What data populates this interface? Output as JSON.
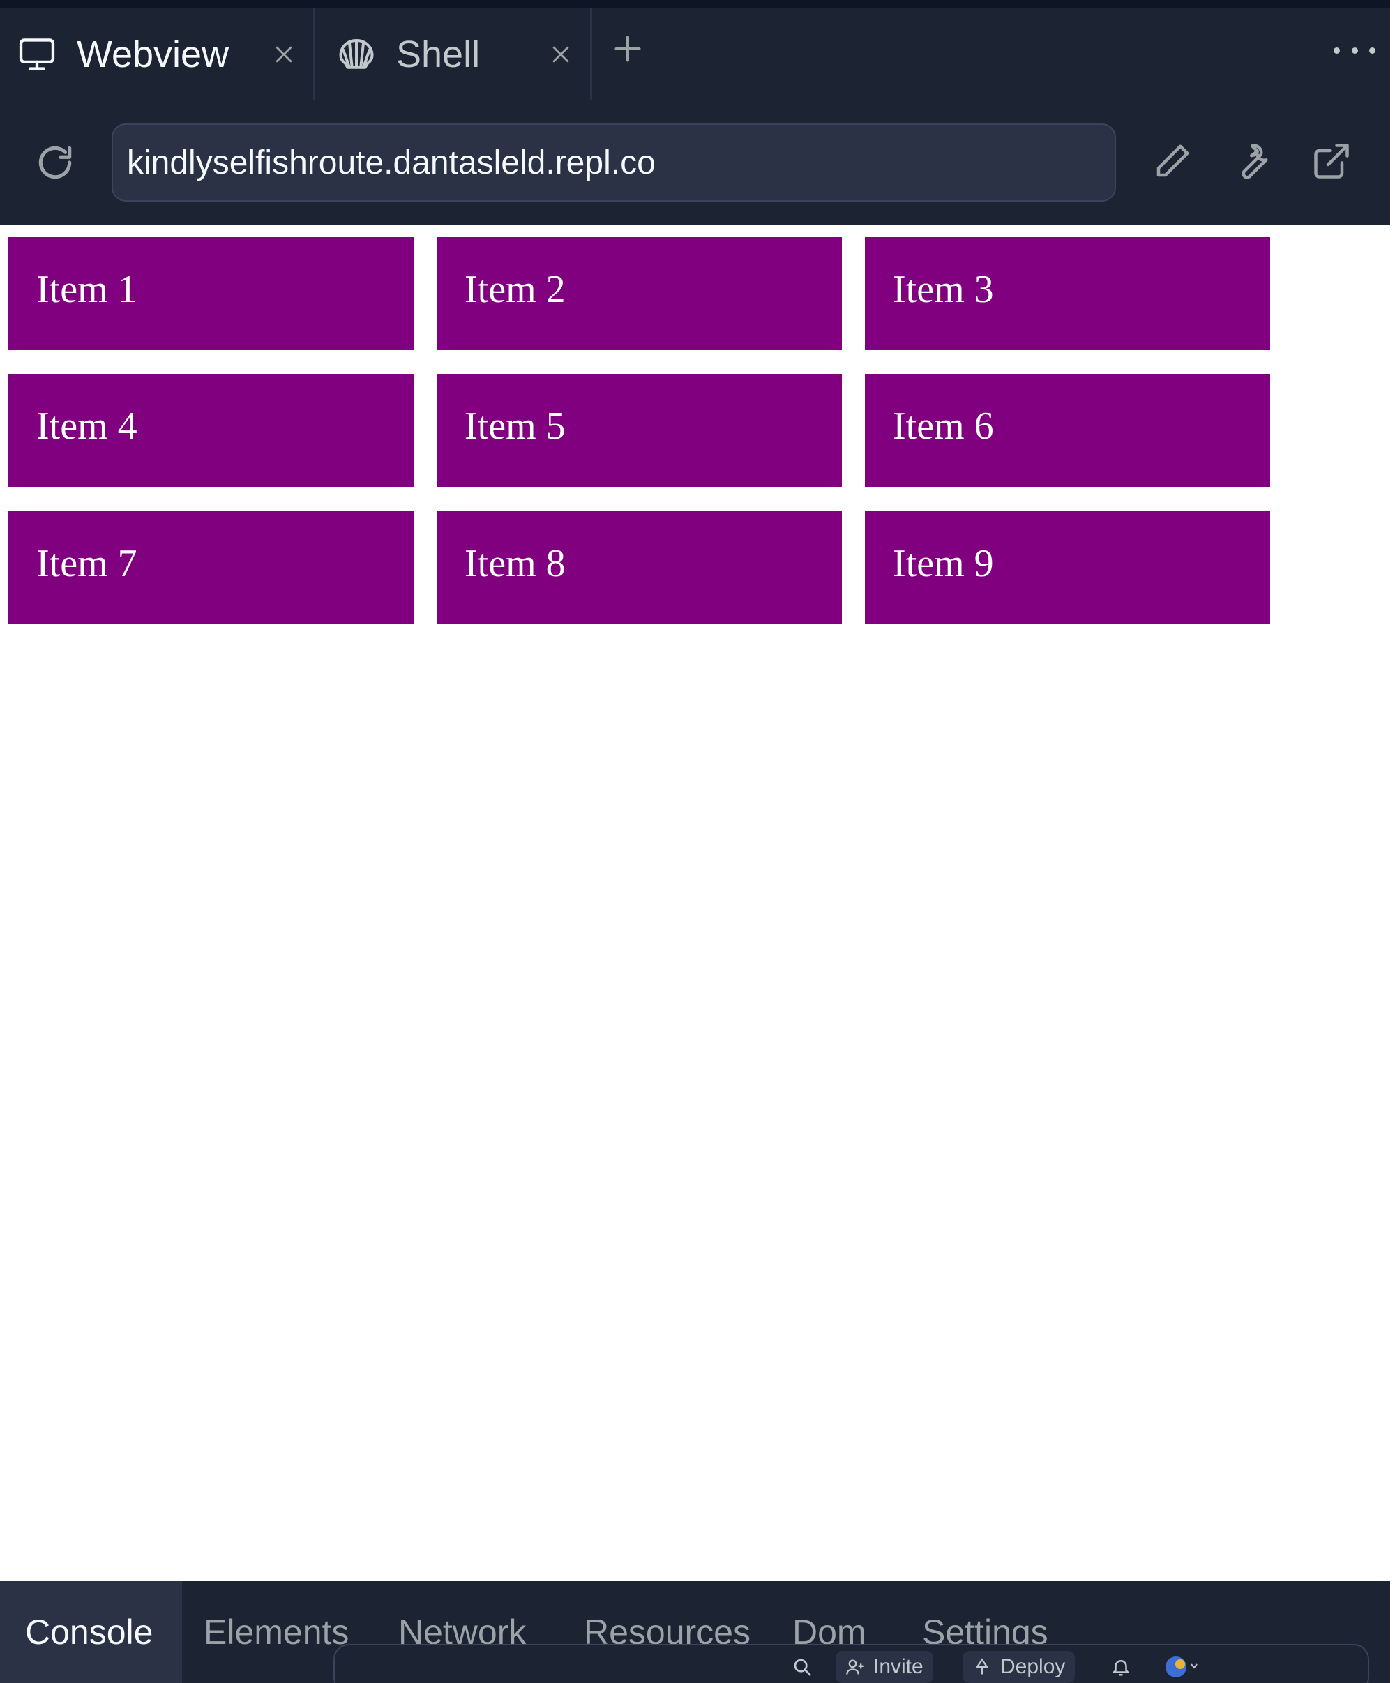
{
  "tabs": [
    {
      "label": "Webview",
      "icon": "monitor-icon",
      "active": true
    },
    {
      "label": "Shell",
      "icon": "shell-icon",
      "active": false
    }
  ],
  "address_bar": {
    "url": "kindlyselfishroute.dantasleld.repl.co"
  },
  "page": {
    "item_color": "#800080",
    "items": [
      "Item 1",
      "Item 2",
      "Item 3",
      "Item 4",
      "Item 5",
      "Item 6",
      "Item 7",
      "Item 8",
      "Item 9"
    ]
  },
  "devtools": {
    "tabs": [
      "Console",
      "Elements",
      "Network",
      "Resources",
      "Dom",
      "Settings"
    ],
    "active": "Console"
  },
  "overlay": {
    "invite_label": "Invite",
    "deploy_label": "Deploy"
  }
}
